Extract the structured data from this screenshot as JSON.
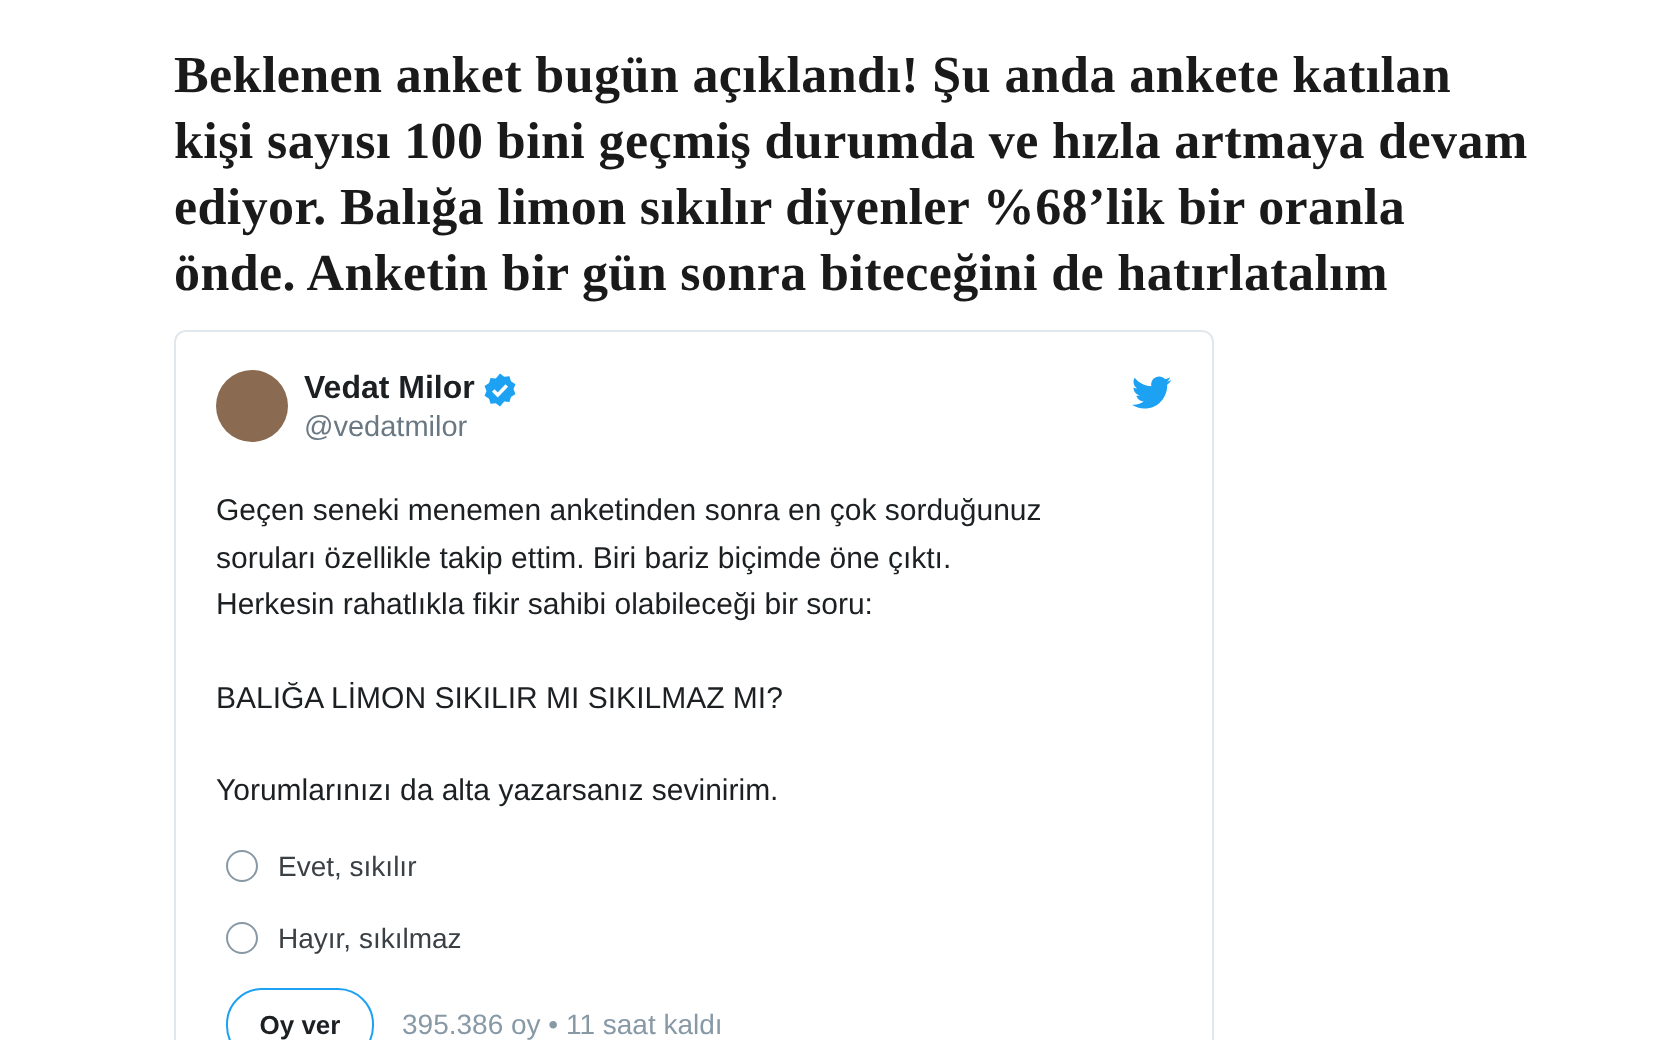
{
  "headline": "Beklenen anket bugün açıklandı! Şu anda ankete katılan\nkişi sayısı 100 bini geçmiş durumda ve hızla artmaya devam\nediyor. Balığa limon sıkılır diyenler %68’lik bir oranla\nönde. Anketin bir gün sonra biteceğini de hatırlatalım",
  "tweet": {
    "name": "Vedat Milor",
    "verified": true,
    "handle": "@vedatmilor",
    "paragraphs": [
      "Geçen seneki menemen anketinden sonra en çok sorduğunuz\nsoruları özellikle takip ettim. Biri bariz biçimde öne çıktı.\nHerkesin rahatlıkla fikir sahibi olabileceği bir soru:",
      "BALIĞA LİMON SIKILIR MI SIKILMAZ MI?",
      "Yorumlarınızı da alta yazarsanız sevinirim."
    ],
    "poll": {
      "options": [
        {
          "label": "Evet, sıkılır",
          "selected": false
        },
        {
          "label": "Hayır, sıkılmaz",
          "selected": false
        }
      ],
      "vote_button": "Oy ver",
      "meta": "395.386 oy • 11 saat kaldı"
    }
  }
}
